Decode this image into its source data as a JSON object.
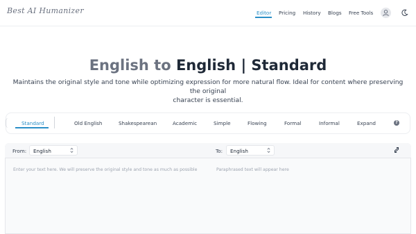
{
  "brand": {
    "logo_text": "Best AI Humanizer"
  },
  "nav": {
    "items": [
      {
        "label": "Editor"
      },
      {
        "label": "Pricing"
      },
      {
        "label": "History"
      },
      {
        "label": "Blogs"
      },
      {
        "label": "Free Tools"
      }
    ],
    "active": "Editor"
  },
  "hero": {
    "title_part1": "English to ",
    "title_part2": "English | Standard",
    "description_line1": "Maintains the original style and tone while optimizing expression for more natural flow. Ideal for content where preserving the original",
    "description_line2": "character is essential."
  },
  "modes": {
    "items": [
      {
        "label": "Standard"
      },
      {
        "label": "Old English"
      },
      {
        "label": "Shakespearean"
      },
      {
        "label": "Academic"
      },
      {
        "label": "Simple"
      },
      {
        "label": "Flowing"
      },
      {
        "label": "Formal"
      },
      {
        "label": "Informal"
      },
      {
        "label": "Expand"
      }
    ],
    "active": "Standard",
    "help_glyph": "?"
  },
  "editor": {
    "from_label": "From:",
    "from_value": "English",
    "to_label": "To:",
    "to_value": "English",
    "input_placeholder": "Enter your text here. We will preserve the original style and tone as much as possible",
    "output_placeholder": "Paraphrased text will appear here"
  },
  "colors": {
    "accent": "#2a8fc7",
    "title_muted": "#6b7280",
    "title_dark": "#1f2937"
  },
  "icons": {
    "avatar": "user-avatar-icon",
    "theme": "moon-icon",
    "help": "help-circle-icon",
    "swap": "swap-arrows-icon",
    "select_chevron": "updown-chevron-icon"
  }
}
